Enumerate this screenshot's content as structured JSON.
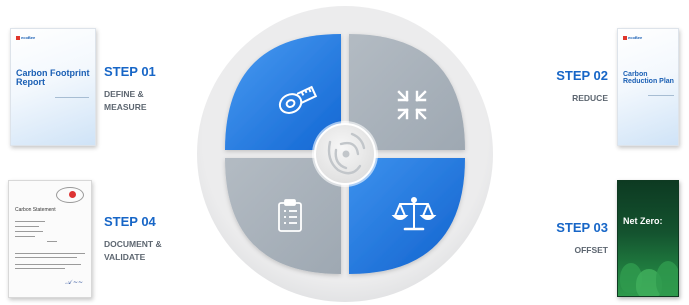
{
  "steps": [
    {
      "label": "STEP 01",
      "desc_line1": "DEFINE &",
      "desc_line2": "MEASURE"
    },
    {
      "label": "STEP 02",
      "desc_line1": "REDUCE"
    },
    {
      "label": "STEP 03",
      "desc_line1": "OFFSET"
    },
    {
      "label": "STEP 04",
      "desc_line1": "DOCUMENT &",
      "desc_line2": "VALIDATE"
    }
  ],
  "documents": {
    "footprint_report": {
      "logo": "ecoBee",
      "title_line1": "Carbon Footprint",
      "title_line2": "Report"
    },
    "reduction_plan": {
      "logo": "ecoBee",
      "title_line1": "Carbon",
      "title_line2": "Reduction Plan"
    },
    "net_zero": {
      "title": "Net Zero:"
    },
    "carbon_statement": {
      "heading": "Carbon Statement"
    }
  },
  "icons": {
    "q1": "tape-measure-icon",
    "q2": "shrink-arrows-icon",
    "q3": "scales-icon",
    "q4": "clipboard-icon",
    "center": "leaf-swirl-icon"
  },
  "colors": {
    "accent_blue": "#1a73e3",
    "quadrant_gray": "#a9b2bb",
    "ring_gray": "#e6e7e8",
    "step_text_blue": "#1766c7",
    "desc_gray": "#5d6670"
  }
}
